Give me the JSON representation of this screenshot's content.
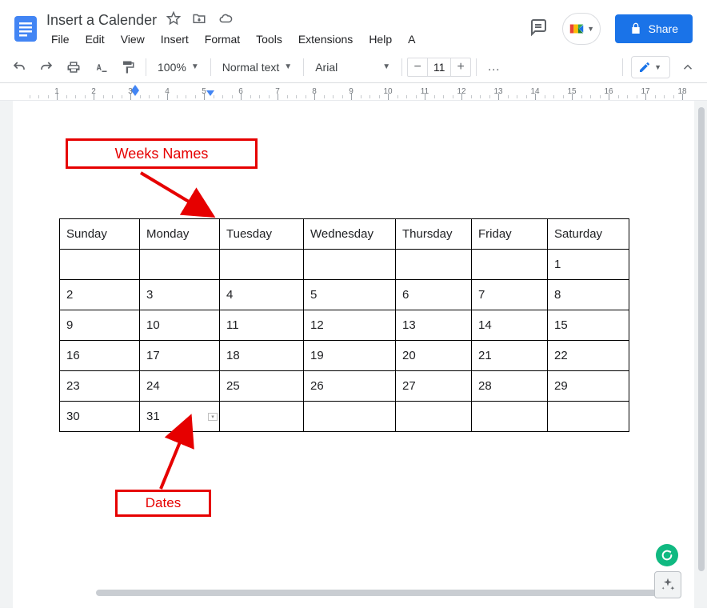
{
  "header": {
    "title": "Insert a Calender",
    "menus": [
      "File",
      "Edit",
      "View",
      "Insert",
      "Format",
      "Tools",
      "Extensions",
      "Help",
      "A"
    ],
    "share_label": "Share"
  },
  "toolbar": {
    "zoom": "100%",
    "style": "Normal text",
    "font": "Arial",
    "font_size": "11"
  },
  "ruler": {
    "numbers": [
      1,
      2,
      3,
      4,
      5,
      6,
      7,
      8,
      9,
      10,
      11,
      12,
      13,
      14,
      15,
      16,
      17,
      18
    ]
  },
  "annotations": {
    "weeks": "Weeks Names",
    "dates": "Dates"
  },
  "calendar": {
    "days": [
      "Sunday",
      "Monday",
      "Tuesday",
      "Wednesday",
      "Thursday",
      "Friday",
      "Saturday"
    ],
    "rows": [
      [
        "",
        "",
        "",
        "",
        "",
        "",
        "1"
      ],
      [
        "2",
        "3",
        "4",
        "5",
        "6",
        "7",
        "8"
      ],
      [
        "9",
        "10",
        "11",
        "12",
        "13",
        "14",
        "15"
      ],
      [
        "16",
        "17",
        "18",
        "19",
        "20",
        "21",
        "22"
      ],
      [
        "23",
        "24",
        "25",
        "26",
        "27",
        "28",
        "29"
      ],
      [
        "30",
        "31",
        "",
        "",
        "",
        "",
        ""
      ]
    ]
  }
}
